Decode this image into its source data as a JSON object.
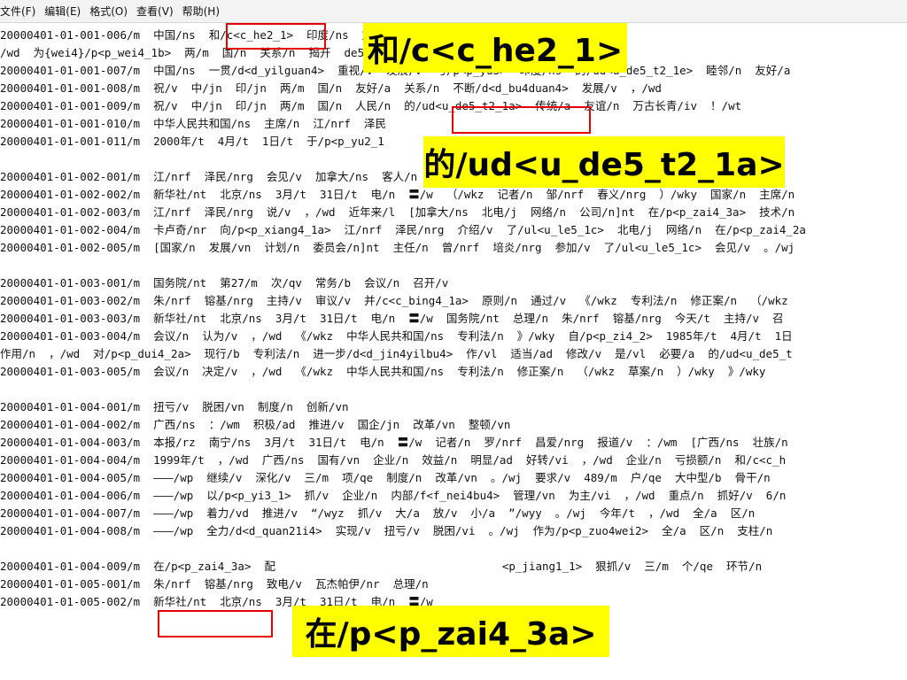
{
  "menu": {
    "items": [
      "文件(F)",
      "编辑(E)",
      "格式(O)",
      "查看(V)",
      "帮助(H)"
    ]
  },
  "editor_lines": [
    "20000401-01-001-006/m  中国/ns  和/c<c_he2_1>  印度/ns  文明/a  古国/n  ，/wd  两/m  国/n  之间",
    "/wd  为{wei4}/p<p_wei4_1b>  两/m  国/n  关系/n  揭开  de5_t2_1c>  一/m  页/qe  。/wj  我们/r",
    "20000401-01-001-007/m  中国/ns  一贯/d<d_yilguan4>  重视/v  发展/v  与/p<p_yu3>  印度/ns  的/ud<u_de5_t2_1e>  睦邻/n  友好/a",
    "20000401-01-001-008/m  祝/v  中/jn  印/jn  两/m  国/n  友好/a  关系/n  不断/d<d_bu4duan4>  发展/v  ，/wd",
    "20000401-01-001-009/m  祝/v  中/jn  印/jn  两/m  国/n  人民/n  的/ud<u_de5_t2_1a>  传统/a  友谊/n  万古长青/iv  ！/wt",
    "20000401-01-001-010/m  中华人民共和国/ns  主席/n  江/nrf  泽民",
    "20000401-01-001-011/m  2000年/t  4月/t  1日/t  于/p<p_yu2_1",
    "",
    "20000401-01-002-001/m  江/nrf  泽民/nrg  会见/v  加拿大/ns  客人/n",
    "20000401-01-002-002/m  新华社/nt  北京/ns  3月/t  31日/t  电/n  〓/w  （/wkz  记者/n  邹/nrf  春义/nrg  ）/wky  国家/n  主席/n",
    "20000401-01-002-003/m  江/nrf  泽民/nrg  说/v  ，/wd  近年来/l  [加拿大/ns  北电/j  网络/n  公司/n]nt  在/p<p_zai4_3a>  技术/n",
    "20000401-01-002-004/m  卡卢奇/nr  向/p<p_xiang4_1a>  江/nrf  泽民/nrg  介绍/v  了/ul<u_le5_1c>  北电/j  网络/n  在/p<p_zai4_2a",
    "20000401-01-002-005/m  [国家/n  发展/vn  计划/n  委员会/n]nt  主任/n  曾/nrf  培炎/nrg  参加/v  了/ul<u_le5_1c>  会见/v  。/wj",
    "",
    "20000401-01-003-001/m  国务院/nt  第27/m  次/qv  常务/b  会议/n  召开/v",
    "20000401-01-003-002/m  朱/nrf  镕基/nrg  主持/v  审议/v  并/c<c_bing4_1a>  原则/n  通过/v  《/wkz  专利法/n  修正案/n  （/wkz",
    "20000401-01-003-003/m  新华社/nt  北京/ns  3月/t  31日/t  电/n  〓/w  国务院/nt  总理/n  朱/nrf  镕基/nrg  今天/t  主持/v  召",
    "20000401-01-003-004/m  会议/n  认为/v  ，/wd  《/wkz  中华人民共和国/ns  专利法/n  》/wky  自/p<p_zi4_2>  1985年/t  4月/t  1日",
    "作用/n  ，/wd  对/p<p_dui4_2a>  现行/b  专利法/n  进一步/d<d_jin4yilbu4>  作/vl  适当/ad  修改/v  是/vl  必要/a  的/ud<u_de5_t",
    "20000401-01-003-005/m  会议/n  决定/v  ，/wd  《/wkz  中华人民共和国/ns  专利法/n  修正案/n  （/wkz  草案/n  ）/wky  》/wky",
    "",
    "20000401-01-004-001/m  扭亏/v  脱困/vn  制度/n  创新/vn",
    "20000401-01-004-002/m  广西/ns  ：/wm  积极/ad  推进/v  国企/jn  改革/vn  整顿/vn",
    "20000401-01-004-003/m  本报/rz  南宁/ns  3月/t  31日/t  电/n  〓/w  记者/n  罗/nrf  昌爱/nrg  报道/v  ：/wm  [广西/ns  壮族/n",
    "20000401-01-004-004/m  1999年/t  ，/wd  广西/ns  国有/vn  企业/n  效益/n  明显/ad  好转/vi  ，/wd  企业/n  亏损额/n  和/c<c_h",
    "20000401-01-004-005/m  ———/wp  继续/v  深化/v  三/m  项/qe  制度/n  改革/vn  。/wj  要求/v  489/m  户/qe  大中型/b  骨干/n",
    "20000401-01-004-006/m  ———/wp  以/p<p_yi3_1>  抓/v  企业/n  内部/f<f_nei4bu4>  管理/vn  为主/vi  ，/wd  重点/n  抓好/v  6/n",
    "20000401-01-004-007/m  ———/wp  着力/vd  推进/v  “/wyz  抓/v  大/a  放/v  小/a  ”/wyy  。/wj  今年/t  ，/wd  全/a  区/n",
    "20000401-01-004-008/m  ———/wp  全力/d<d_quan21i4>  实现/v  扭亏/v  脱困/vi  。/wj  作为/p<p_zuo4wei2>  全/a  区/n  支柱/n",
    "",
    "20000401-01-004-009/m  在/p<p_zai4_3a>  配                                  <p_jiang1_1>  狠抓/v  三/m  个/qe  环节/n",
    "20000401-01-005-001/m  朱/nrf  镕基/nrg  致电/v  瓦杰帕伊/nr  总理/n",
    "20000401-01-005-002/m  新华社/nt  北京/ns  3月/t  31日/t  电/n  〓/w"
  ],
  "callouts": [
    {
      "text": "和/c<c_he2_1>"
    },
    {
      "text": "的/ud<u_de5_t2_1a>"
    },
    {
      "text": "在/p<p_zai4_3a>"
    }
  ],
  "colors": {
    "highlight": "#ffff00",
    "box": "#e30000",
    "menubar": "#f3f3f3"
  }
}
